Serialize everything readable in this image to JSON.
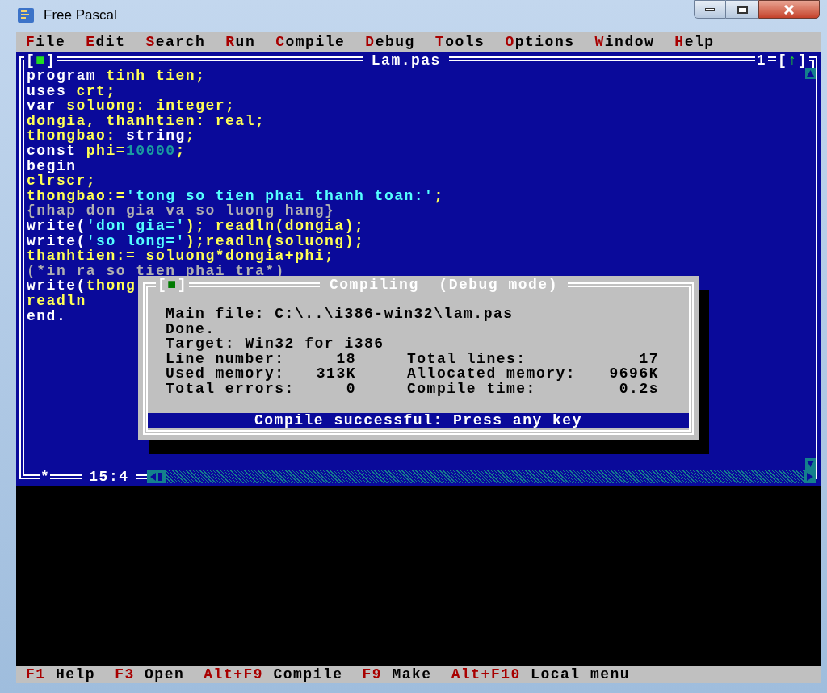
{
  "window": {
    "title": "Free Pascal"
  },
  "menu": [
    {
      "hotkey": "F",
      "rest": "ile"
    },
    {
      "hotkey": "E",
      "rest": "dit"
    },
    {
      "hotkey": "S",
      "rest": "earch"
    },
    {
      "hotkey": "R",
      "rest": "un"
    },
    {
      "hotkey": "C",
      "rest": "ompile"
    },
    {
      "hotkey": "D",
      "rest": "ebug"
    },
    {
      "hotkey": "T",
      "rest": "ools"
    },
    {
      "hotkey": "O",
      "rest": "ptions"
    },
    {
      "hotkey": "W",
      "rest": "indow"
    },
    {
      "hotkey": "H",
      "rest": "elp"
    }
  ],
  "editor": {
    "close_box": {
      "open": "[",
      "glyph": "■",
      "close": "]"
    },
    "title": "Lam.pas",
    "number": "1",
    "zoom_box": {
      "open": "[",
      "glyph": "↑",
      "close": "]"
    },
    "modified": "*",
    "position": "15:4",
    "lines": [
      [
        {
          "kind": "keyword",
          "text": "program"
        },
        {
          "kind": "ident",
          "text": " tinh_tien;"
        }
      ],
      [
        {
          "kind": "keyword",
          "text": "uses"
        },
        {
          "kind": "ident",
          "text": " crt;"
        }
      ],
      [
        {
          "kind": "keyword",
          "text": "var"
        },
        {
          "kind": "ident",
          "text": " soluong: integer;"
        }
      ],
      [
        {
          "kind": "ident",
          "text": "dongia, thanhtien: real;"
        }
      ],
      [
        {
          "kind": "ident",
          "text": "thongbao: "
        },
        {
          "kind": "keyword",
          "text": "string"
        },
        {
          "kind": "ident",
          "text": ";"
        }
      ],
      [
        {
          "kind": "keyword",
          "text": "const"
        },
        {
          "kind": "ident",
          "text": " phi="
        },
        {
          "kind": "number",
          "text": "10000"
        },
        {
          "kind": "ident",
          "text": ";"
        }
      ],
      [
        {
          "kind": "keyword",
          "text": "begin"
        }
      ],
      [
        {
          "kind": "ident",
          "text": "clrscr;"
        }
      ],
      [
        {
          "kind": "ident",
          "text": "thongbao:="
        },
        {
          "kind": "string",
          "text": "'tong so tien phai thanh toan:'"
        },
        {
          "kind": "ident",
          "text": ";"
        }
      ],
      [
        {
          "kind": "comment",
          "text": "{nhap don gia va so luong hang}"
        }
      ],
      [
        {
          "kind": "keyword",
          "text": "write("
        },
        {
          "kind": "string",
          "text": "'don gia='"
        },
        {
          "kind": "ident",
          "text": "); readln(dongia);"
        }
      ],
      [
        {
          "kind": "keyword",
          "text": "write("
        },
        {
          "kind": "string",
          "text": "'so long='"
        },
        {
          "kind": "ident",
          "text": ");readln(soluong);"
        }
      ],
      [
        {
          "kind": "ident",
          "text": "thanhtien:= soluong*dongia+phi;"
        }
      ],
      [
        {
          "kind": "comment",
          "text": "(*in ra so tien phai tra*)"
        }
      ],
      [
        {
          "kind": "keyword",
          "text": "write("
        },
        {
          "kind": "ident",
          "text": "thong"
        }
      ],
      [
        {
          "kind": "ident",
          "text": "readln"
        }
      ],
      [
        {
          "kind": "keyword",
          "text": "end."
        }
      ]
    ]
  },
  "dialog": {
    "close_box": {
      "open": "[",
      "glyph": "■",
      "close": "]"
    },
    "title": "Compiling",
    "mode": "(Debug mode)",
    "lines": [
      "Main file: C:\\..\\i386-win32\\lam.pas",
      "Done.",
      "Target: Win32 for i386"
    ],
    "stats": [
      {
        "left": {
          "label": "Line number:",
          "value": "18"
        },
        "right": {
          "label": "Total lines:",
          "value": "17"
        }
      },
      {
        "left": {
          "label": "Used memory:",
          "value": "313K"
        },
        "right": {
          "label": "Allocated memory:",
          "value": "9696K"
        }
      },
      {
        "left": {
          "label": "Total errors:",
          "value": "0"
        },
        "right": {
          "label": "Compile time:",
          "value": "0.2s"
        }
      }
    ],
    "message": "Compile successful: Press any key"
  },
  "status_bar": [
    {
      "key": "F1",
      "label": "Help"
    },
    {
      "key": "F3",
      "label": "Open"
    },
    {
      "key": "Alt+F9",
      "label": "Compile"
    },
    {
      "key": "F9",
      "label": "Make"
    },
    {
      "key": "Alt+F10",
      "label": "Local menu"
    }
  ]
}
